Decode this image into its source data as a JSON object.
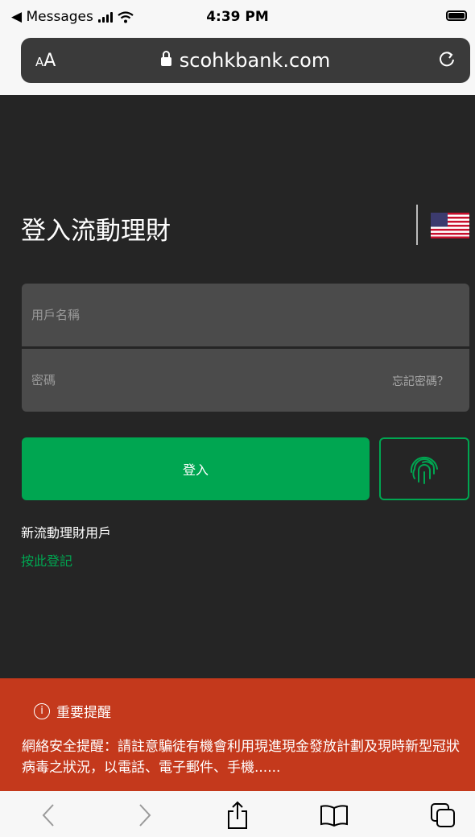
{
  "status": {
    "back_app": "◀ Messages",
    "time": "4:39 PM"
  },
  "browser": {
    "aa_small": "A",
    "aa_large": "A",
    "url": "scohkbank.com"
  },
  "page": {
    "title": "登入流動理財",
    "username_placeholder": "用戶名稱",
    "password_placeholder": "密碼",
    "forgot_password": "忘記密碼？",
    "login_button": "登入",
    "new_user": "新流動理財用戶",
    "register_link": "按此登記"
  },
  "alert": {
    "icon": "i",
    "title": "重要提醒",
    "body": "網絡安全提醒：請註意騙徒有機會利用現進現金發放計劃及現時新型冠狀病毒之狀況，以電話、電子郵件、手機......"
  },
  "colors": {
    "accent_green": "#00a651",
    "alert_red": "#c4391c",
    "background": "#252525"
  },
  "icons": [
    "lock-icon",
    "reload-icon",
    "us-flag-icon",
    "fingerprint-icon",
    "info-icon",
    "back-icon",
    "forward-icon",
    "share-icon",
    "bookmarks-icon",
    "tabs-icon"
  ]
}
